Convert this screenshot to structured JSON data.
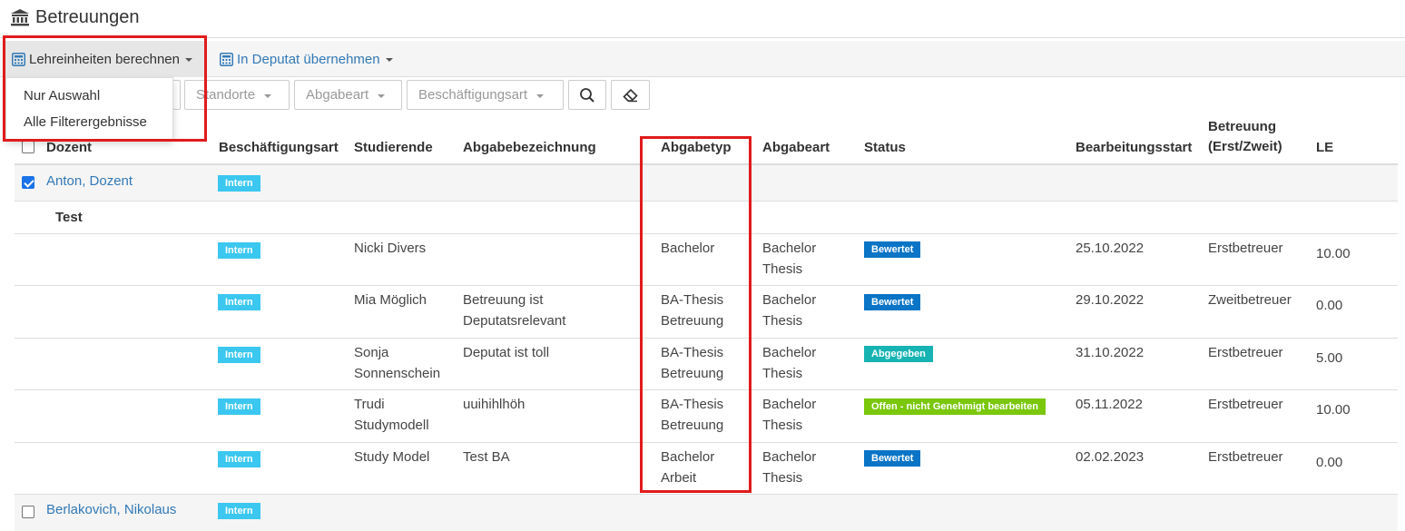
{
  "page": {
    "title": "Betreuungen",
    "icon": "institution-icon"
  },
  "toolbar": {
    "calc_button": "Lehreinheiten berechnen",
    "deputat_button": "In Deputat übernehmen"
  },
  "dropdown": {
    "items": [
      "Nur Auswahl",
      "Alle Filterergebnisse"
    ]
  },
  "filters": {
    "standorte": "Standorte",
    "abgabeart": "Abgabeart",
    "beschaeftigungsart": "Beschäftigungsart"
  },
  "table": {
    "headers": {
      "dozent": "Dozent",
      "beschaeftigungsart": "Beschäftigungsart",
      "studierende": "Studierende",
      "abgabebezeichnung": "Abgabebezeichnung",
      "abgabetyp": "Abgabetyp",
      "abgabeart": "Abgabeart",
      "status": "Status",
      "bearbeitungsstart": "Bearbeitungsstart",
      "betreuung_1": "Betreuung",
      "betreuung_2": "(Erst/Zweit)",
      "le": "LE"
    },
    "dozent1": {
      "name": "Anton, Dozent",
      "badge": "Intern",
      "checked": true
    },
    "group_label": "Test",
    "rows": [
      {
        "badge": "Intern",
        "student": [
          "Nicki Divers"
        ],
        "bezeichnung": [],
        "typ": [
          "Bachelor"
        ],
        "art": [
          "Bachelor",
          "Thesis"
        ],
        "status": "Bewertet",
        "status_color": "#0a74c6",
        "start": "25.10.2022",
        "betreuung": "Erstbetreuer",
        "le": "10.00"
      },
      {
        "badge": "Intern",
        "student": [
          "Mia Möglich"
        ],
        "bezeichnung": [
          "Betreuung ist",
          "Deputatsrelevant"
        ],
        "typ": [
          "BA-Thesis",
          "Betreuung"
        ],
        "art": [
          "Bachelor",
          "Thesis"
        ],
        "status": "Bewertet",
        "status_color": "#0a74c6",
        "start": "29.10.2022",
        "betreuung": "Zweitbetreuer",
        "le": "0.00"
      },
      {
        "badge": "Intern",
        "student": [
          "Sonja",
          "Sonnenschein"
        ],
        "bezeichnung": [
          "Deputat ist toll"
        ],
        "typ": [
          "BA-Thesis",
          "Betreuung"
        ],
        "art": [
          "Bachelor",
          "Thesis"
        ],
        "status": "Abgegeben",
        "status_color": "#17b3b3",
        "start": "31.10.2022",
        "betreuung": "Erstbetreuer",
        "le": "5.00"
      },
      {
        "badge": "Intern",
        "student": [
          "Trudi",
          "Studymodell"
        ],
        "bezeichnung": [
          "uuihihlhöh"
        ],
        "typ": [
          "BA-Thesis",
          "Betreuung"
        ],
        "art": [
          "Bachelor",
          "Thesis"
        ],
        "status": "Offen - nicht Genehmigt bearbeiten",
        "status_color": "#7ac70c",
        "start": "05.11.2022",
        "betreuung": "Erstbetreuer",
        "le": "10.00"
      },
      {
        "badge": "Intern",
        "student": [
          "Study Model"
        ],
        "bezeichnung": [
          "Test BA"
        ],
        "typ": [
          "Bachelor",
          "Arbeit"
        ],
        "art": [
          "Bachelor",
          "Thesis"
        ],
        "status": "Bewertet",
        "status_color": "#0a74c6",
        "start": "02.02.2023",
        "betreuung": "Erstbetreuer",
        "le": "0.00"
      }
    ],
    "dozent2": {
      "name": "Berlakovich, Nikolaus",
      "badge": "Intern",
      "checked": false
    }
  },
  "highlight_color": "#e01b1b"
}
